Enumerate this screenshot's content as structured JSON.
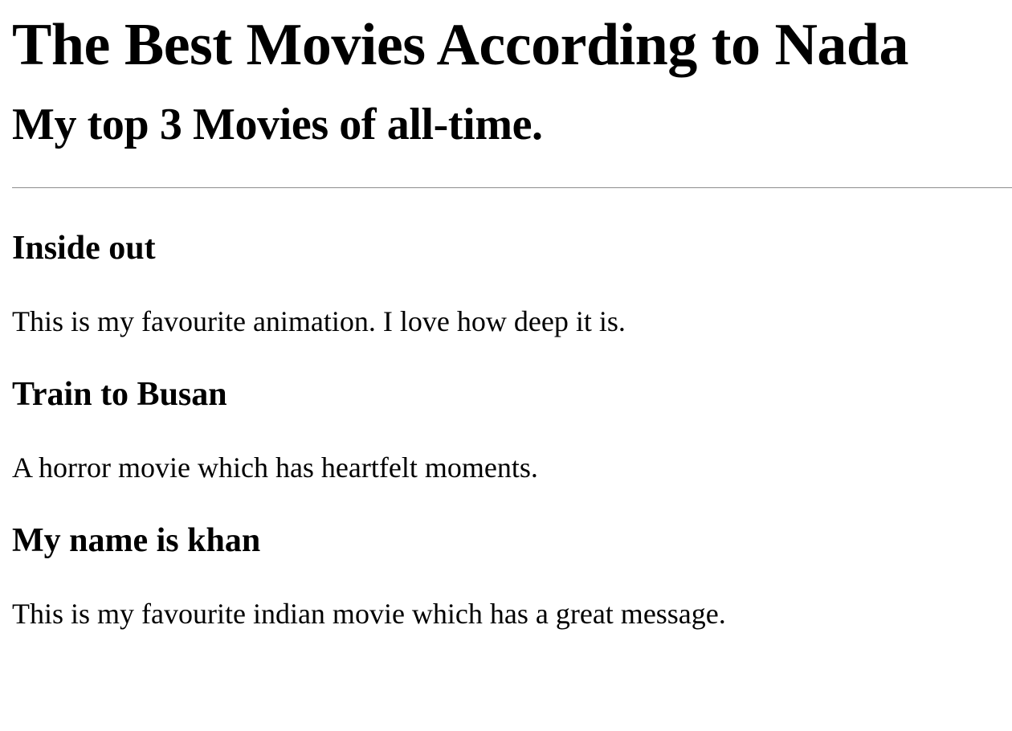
{
  "header": {
    "title": "The Best Movies According to Nada",
    "subtitle": "My top 3 Movies of all-time."
  },
  "movies": [
    {
      "title": "Inside out",
      "description": "This is my favourite animation. I love how deep it is."
    },
    {
      "title": "Train to Busan",
      "description": "A horror movie which has heartfelt moments."
    },
    {
      "title": "My name is khan",
      "description": "This is my favourite indian movie which has a great message."
    }
  ]
}
